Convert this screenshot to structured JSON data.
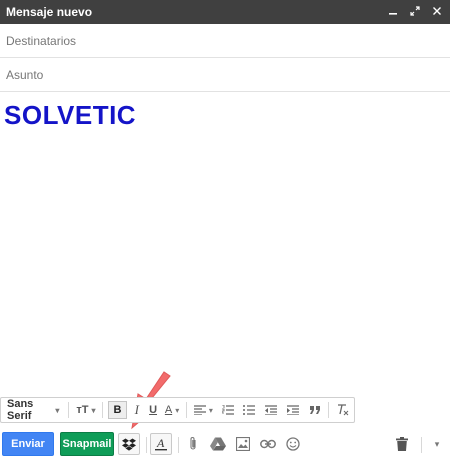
{
  "window": {
    "title": "Mensaje nuevo"
  },
  "fields": {
    "to_placeholder": "Destinatarios",
    "subject_placeholder": "Asunto"
  },
  "body": {
    "text": "SOLVETIC"
  },
  "format_toolbar": {
    "font_label": "Sans Serif",
    "size_label": "тT",
    "bold_label": "B",
    "italic_label": "I",
    "underline_label": "U",
    "text_color_label": "A"
  },
  "bottom_toolbar": {
    "send_label": "Enviar",
    "snapmail_label": "Snapmail"
  },
  "colors": {
    "send": "#4285f4",
    "snapmail": "#0f9d58",
    "title_bar": "#404040",
    "body_text": "#1414c8",
    "arrow": "#f26b6b"
  }
}
